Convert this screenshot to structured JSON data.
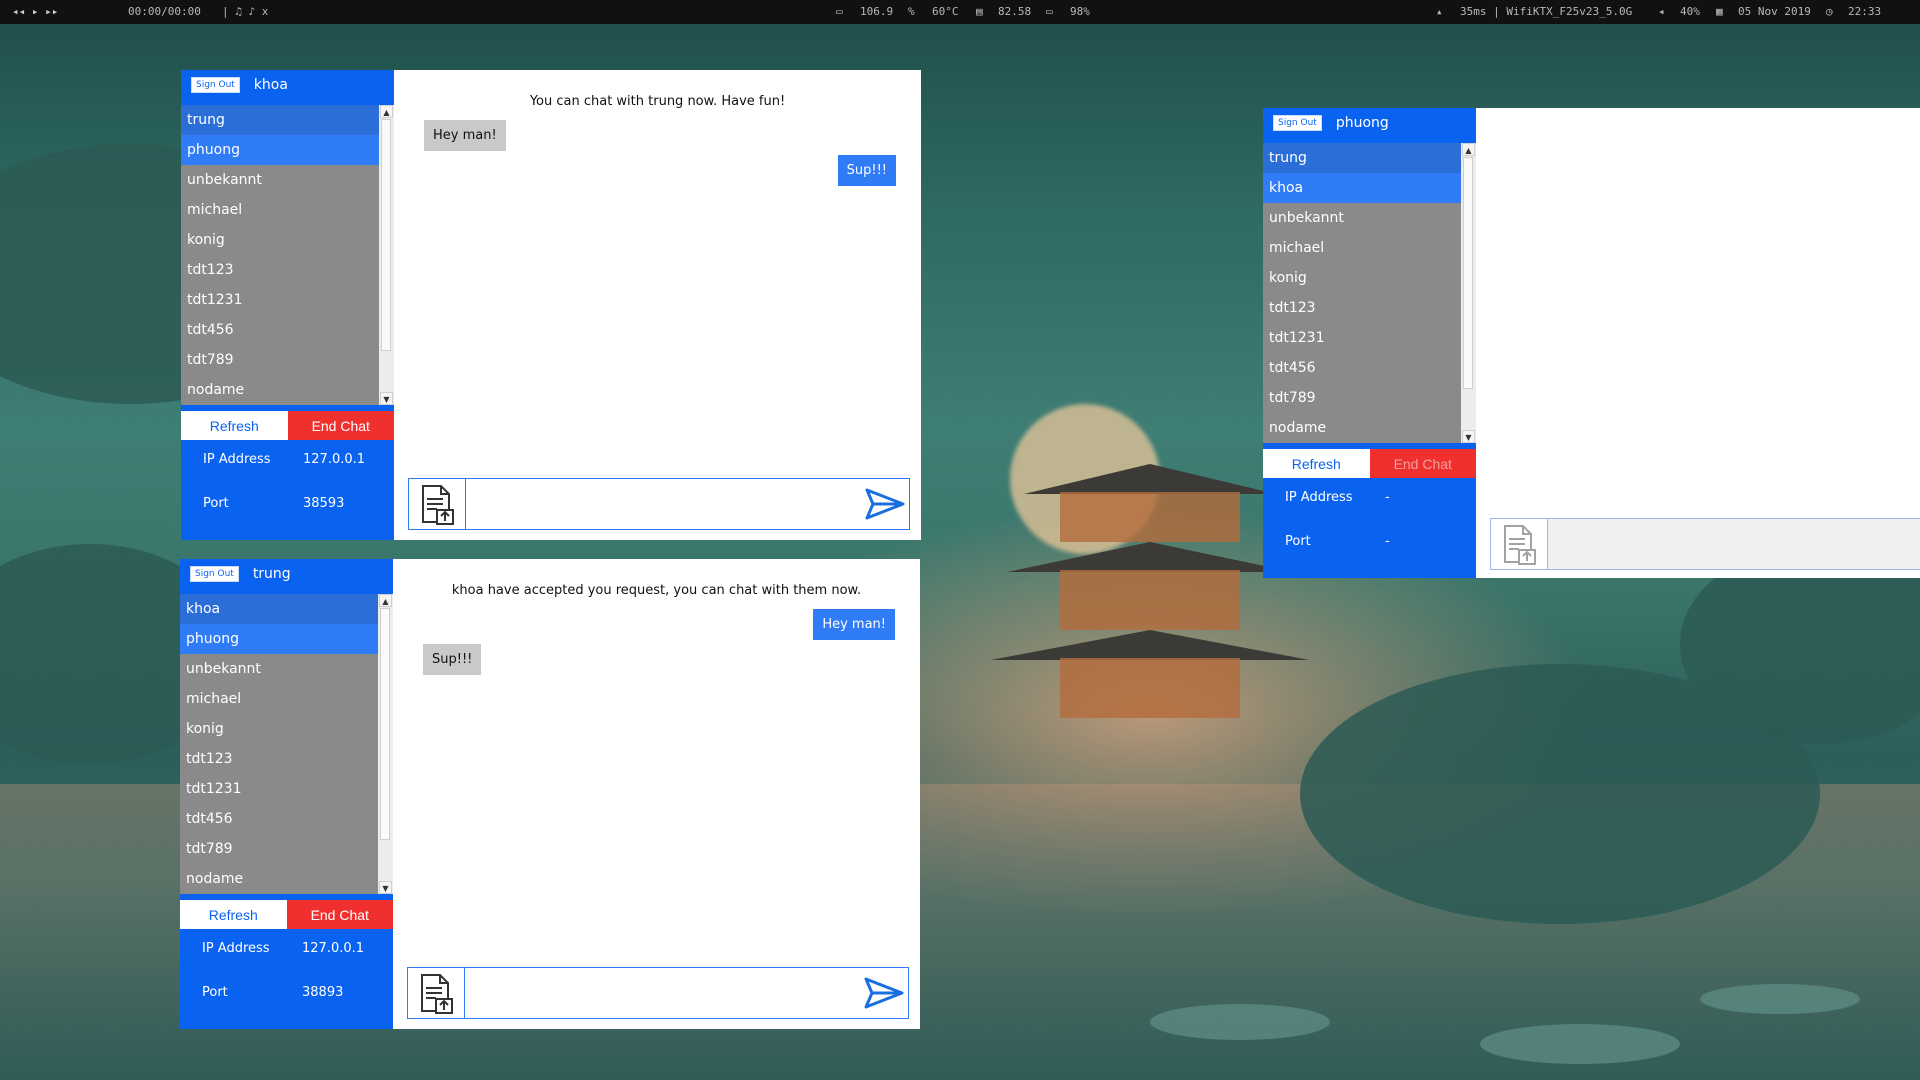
{
  "topbar": {
    "media_controls": "◂◂  ▸  ▸▸",
    "time": "00:00/00:00",
    "music": "|  ♫  ♪ x",
    "cpu": "106.9",
    "temp": "60°C",
    "mem": "82.58",
    "battery": "98%",
    "network": "35ms | WifiKTX_F25v23_5.0G",
    "volume": "40%",
    "date": "05 Nov 2019",
    "clock": "22:33"
  },
  "windows": {
    "khoa": {
      "sign_out": "Sign Out",
      "username": "khoa",
      "contacts": [
        "trung",
        "phuong",
        "unbekannt",
        "michael",
        "konig",
        "tdt123",
        "tdt1231",
        "tdt456",
        "tdt789",
        "nodame"
      ],
      "refresh": "Refresh",
      "end_chat": "End Chat",
      "ip_label": "IP Address",
      "ip_value": "127.0.0.1",
      "port_label": "Port",
      "port_value": "38593",
      "system_message": "You can chat with trung now. Have fun!",
      "messages": [
        {
          "from": "in",
          "text": "Hey man!"
        },
        {
          "from": "out",
          "text": "Sup!!!"
        }
      ]
    },
    "trung": {
      "sign_out": "Sign Out",
      "username": "trung",
      "contacts": [
        "khoa",
        "phuong",
        "unbekannt",
        "michael",
        "konig",
        "tdt123",
        "tdt1231",
        "tdt456",
        "tdt789",
        "nodame"
      ],
      "refresh": "Refresh",
      "end_chat": "End Chat",
      "ip_label": "IP Address",
      "ip_value": "127.0.0.1",
      "port_label": "Port",
      "port_value": "38893",
      "system_message": "khoa have accepted you request, you can chat with them now.",
      "messages": [
        {
          "from": "out",
          "text": "Hey man!"
        },
        {
          "from": "in",
          "text": "Sup!!!"
        }
      ]
    },
    "phuong": {
      "sign_out": "Sign Out",
      "username": "phuong",
      "contacts": [
        "trung",
        "khoa",
        "unbekannt",
        "michael",
        "konig",
        "tdt123",
        "tdt1231",
        "tdt456",
        "tdt789",
        "nodame"
      ],
      "refresh": "Refresh",
      "end_chat": "End Chat",
      "ip_label": "IP Address",
      "ip_value": "-",
      "port_label": "Port",
      "port_value": "-"
    }
  },
  "colors": {
    "accent": "#0a63f0",
    "danger": "#f0302f",
    "list_bg": "#8a8a8a"
  }
}
